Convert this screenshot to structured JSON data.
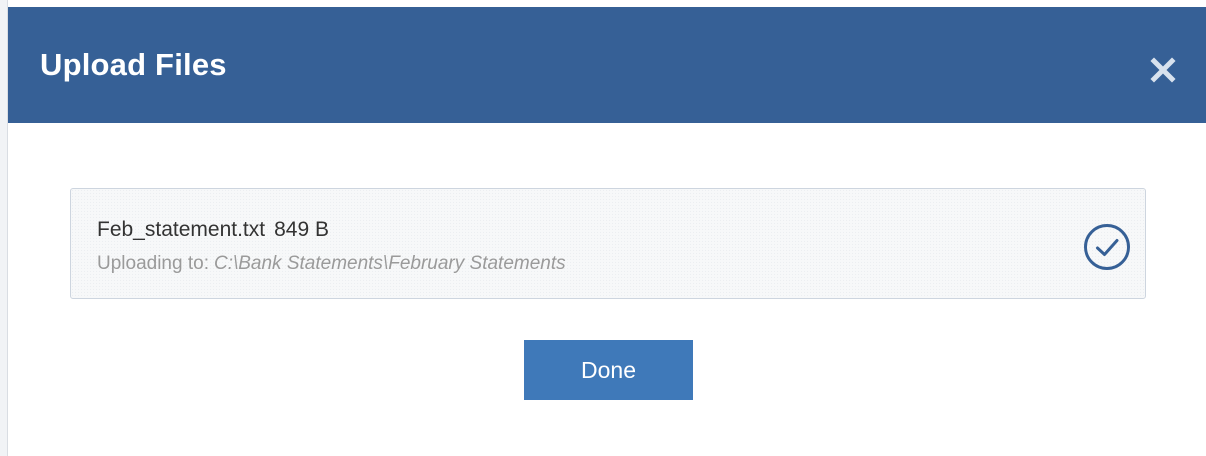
{
  "dialog": {
    "title": "Upload Files",
    "close_icon": "close-icon",
    "header_color": "#366096"
  },
  "upload": {
    "file_name": "Feb_statement.txt",
    "file_size": "849 B",
    "destination_label": "Uploading to:",
    "destination_path": "C:\\Bank Statements\\February Statements",
    "status_icon": "check-circle-icon",
    "status_color": "#366096"
  },
  "actions": {
    "done_label": "Done",
    "done_color": "#3f79b9"
  }
}
